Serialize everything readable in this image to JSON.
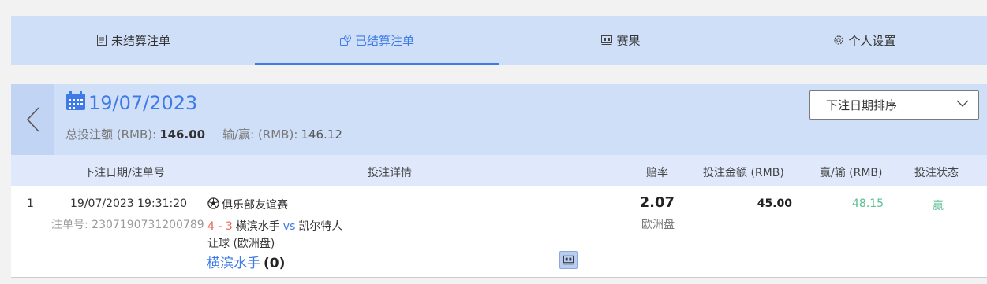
{
  "tabs": [
    {
      "label": "未结算注单",
      "icon": "document-list-icon"
    },
    {
      "label": "已结算注单",
      "icon": "coin-settled-icon",
      "active": true
    },
    {
      "label": "赛果",
      "icon": "scoreboard-icon"
    },
    {
      "label": "个人设置",
      "icon": "gear-icon"
    }
  ],
  "date_panel": {
    "date": "19/07/2023",
    "total_label": "总投注额 (RMB):",
    "total_value": "146.00",
    "winloss_label": "输/赢: (RMB):",
    "winloss_value": "146.12",
    "sort_selected": "下注日期排序"
  },
  "columns": {
    "date_ticket": "下注日期/注单号",
    "details": "投注详情",
    "odds": "赔率",
    "amount": "投注金额 (RMB)",
    "winloss": "赢/输 (RMB)",
    "status": "投注状态"
  },
  "rows": [
    {
      "index": "1",
      "datetime": "19/07/2023 19:31:20",
      "ticket": "注单号: 2307190731200789",
      "league": "俱乐部友谊赛",
      "score": "4 - 3",
      "home": "横滨水手",
      "vs": "vs",
      "away": "凯尔特人",
      "market": "让球 (欧洲盘)",
      "pick": "横滨水手",
      "handicap": "(0)",
      "odds": "2.07",
      "odds_type": "欧洲盘",
      "amount": "45.00",
      "winloss": "48.15",
      "status": "赢"
    }
  ],
  "colors": {
    "accent": "#3e7be6",
    "panel": "#d0dff8",
    "win": "#5bbf95",
    "score": "#e8675b"
  }
}
